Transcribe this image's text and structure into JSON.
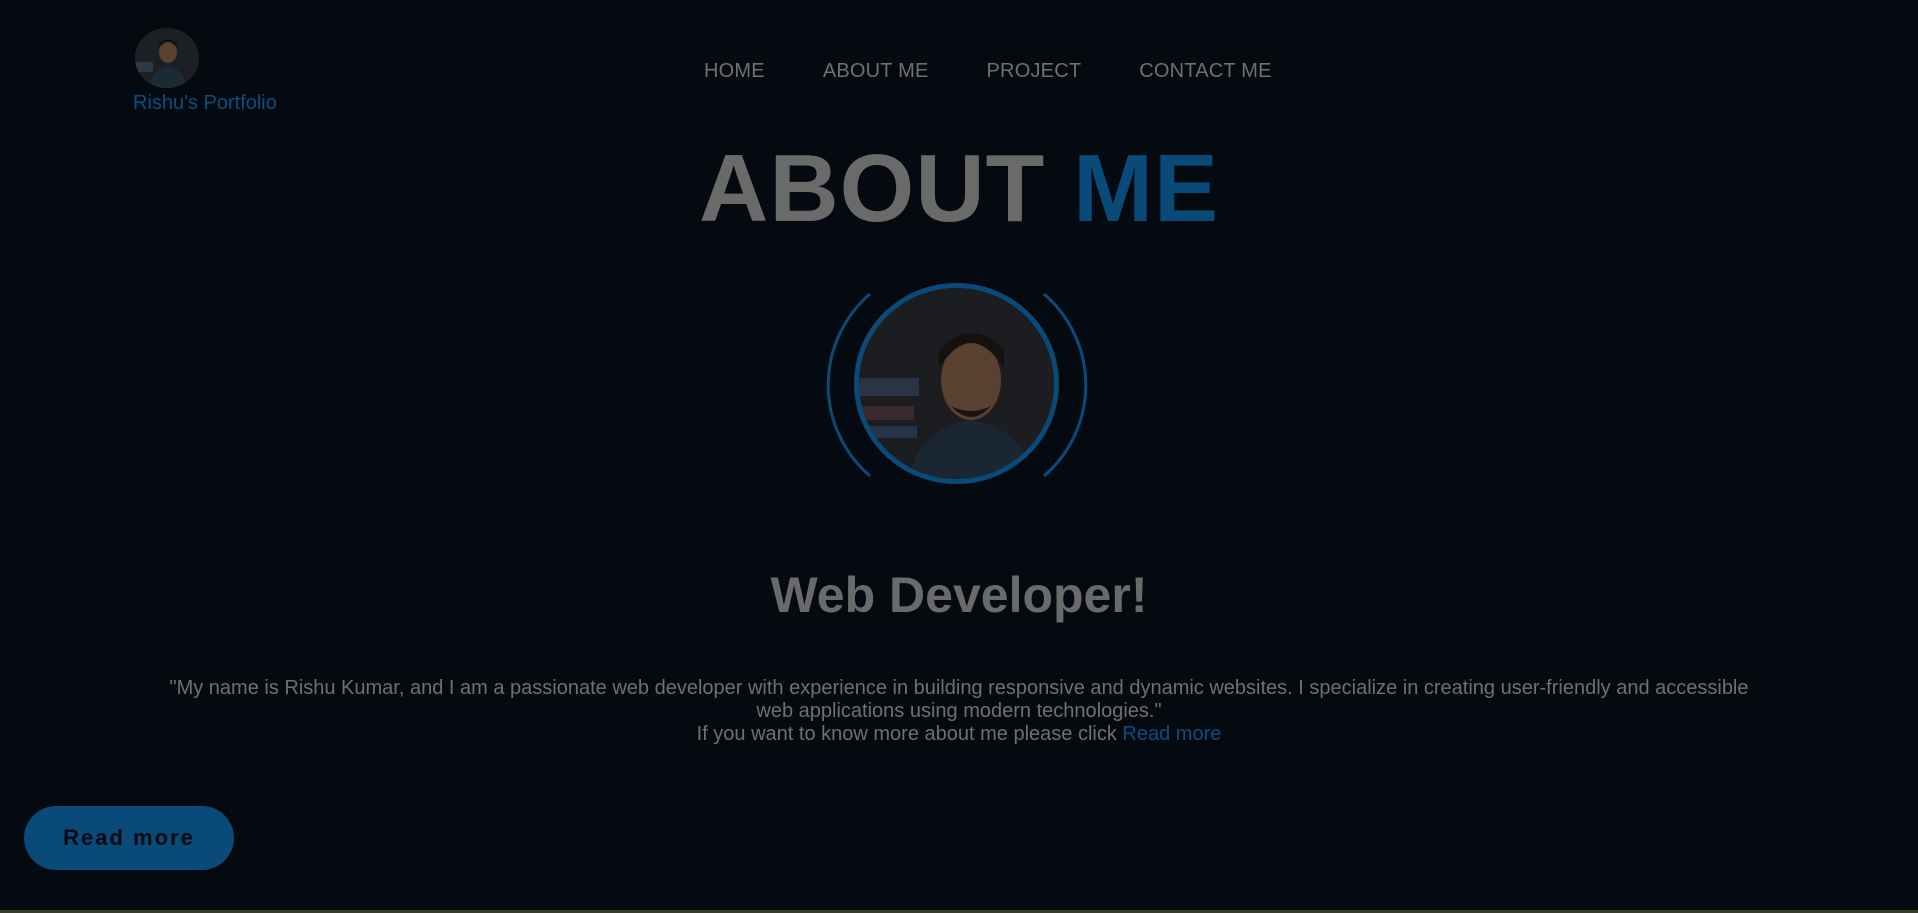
{
  "logo": {
    "text": "Rishu's Portfolio"
  },
  "nav": {
    "items": [
      {
        "label": "HOME"
      },
      {
        "label": "ABOUT ME"
      },
      {
        "label": "PROJECT"
      },
      {
        "label": "CONTACT ME"
      }
    ]
  },
  "about": {
    "title_main": "ABOUT",
    "title_accent": "ME",
    "subtitle": "Web Developer!",
    "bio_line": "\"My name is Rishu Kumar, and I am a passionate web developer with experience in building responsive and dynamic websites. I specialize in creating user-friendly and accessible web applications using modern technologies.\"",
    "cta_prefix": "If you want to know more about me please click",
    "cta_link": "Read more"
  },
  "button": {
    "label": "Read more"
  },
  "colors": {
    "accent": "#0a4a78",
    "background": "#040a10",
    "text": "#6f7070"
  }
}
